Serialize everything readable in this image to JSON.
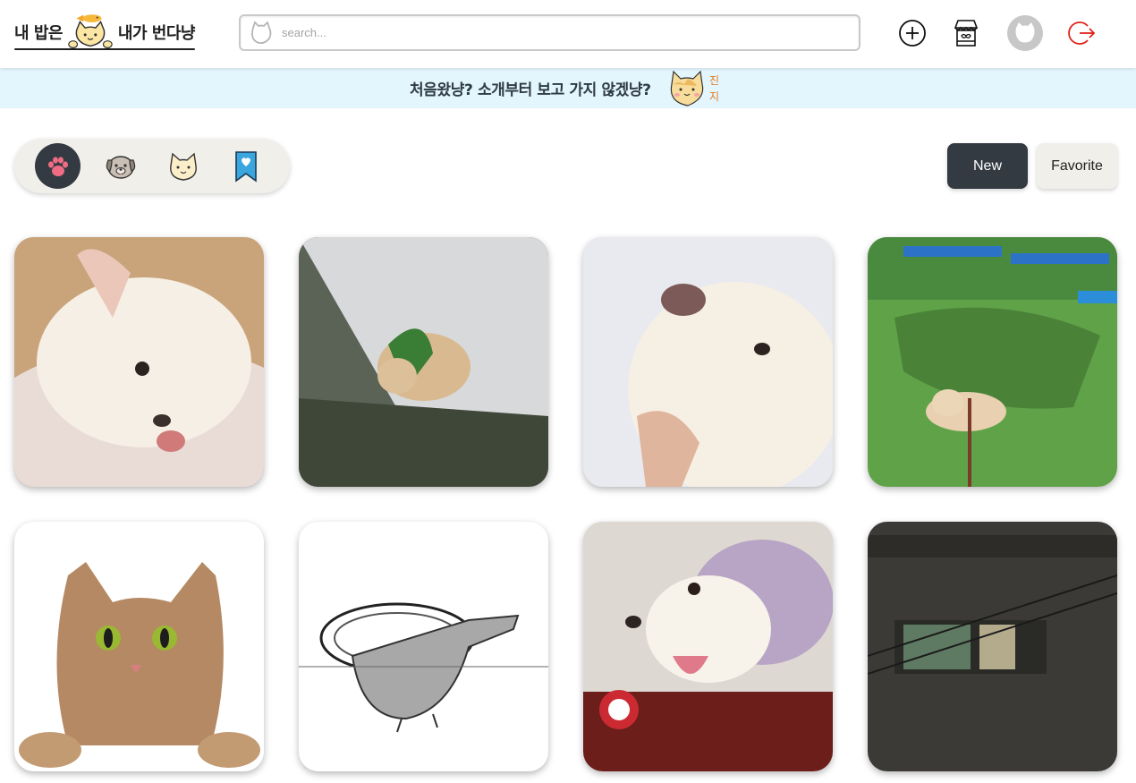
{
  "header": {
    "logo": {
      "left_text": "내 밥은",
      "right_text": "내가 번다냥"
    },
    "search": {
      "placeholder": "search..."
    },
    "icons": [
      "add-icon",
      "shop-icon",
      "profile-avatar",
      "logout-icon"
    ]
  },
  "banner": {
    "text": "처음왔냥?  소개부터 보고 가지 않겠냥?",
    "badge": [
      "진",
      "지"
    ]
  },
  "filters": {
    "items": [
      {
        "name": "all",
        "icon": "paw-icon",
        "selected": true
      },
      {
        "name": "dog",
        "icon": "dog-icon",
        "selected": false
      },
      {
        "name": "cat",
        "icon": "cat-icon",
        "selected": false
      },
      {
        "name": "bookmark",
        "icon": "bookmark-heart-icon",
        "selected": false
      }
    ]
  },
  "sort": {
    "new_label": "New",
    "favorite_label": "Favorite",
    "active": "New"
  },
  "gallery": {
    "photos": [
      {
        "subject": "white dog lying on cushion"
      },
      {
        "subject": "dog in green sweater in snow"
      },
      {
        "subject": "white dog looking up in snow"
      },
      {
        "subject": "dog lying on artificial grass"
      },
      {
        "subject": "tabby cat peeking"
      },
      {
        "subject": "drawing of bird"
      },
      {
        "subject": "white dog with purple hat"
      },
      {
        "subject": "building at night"
      }
    ]
  },
  "colors": {
    "dark": "#343a42",
    "banner_bg": "#e3f5fd",
    "pill_bg": "#f1efea",
    "logout_red": "#e2231a",
    "paw_pink": "#f06c85",
    "bookmark_blue": "#3aa6dd"
  }
}
